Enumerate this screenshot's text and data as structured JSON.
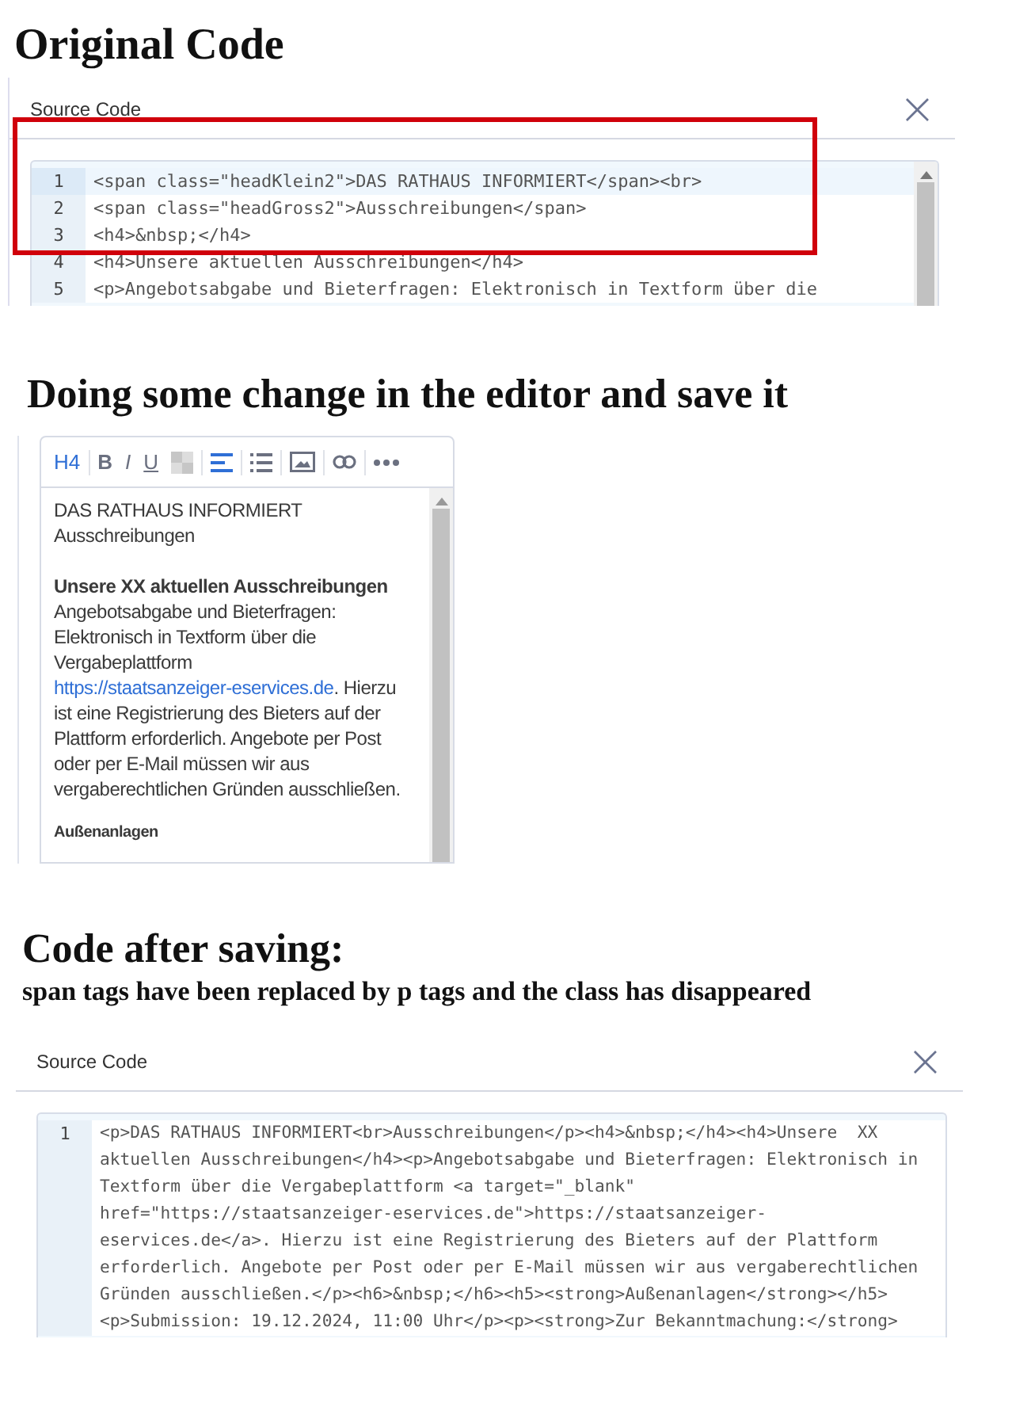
{
  "sections": [
    {
      "kind": "dialog",
      "heading": "Original Code",
      "highlight": true,
      "dialog": {
        "title": "Source Code",
        "close": "×",
        "lines": [
          {
            "number": "1",
            "active": true,
            "segments": [
              "<span class=\"headKlein2\">DAS RATHAUS INFORMIERT</span><br>"
            ]
          },
          {
            "number": "2",
            "active": false,
            "segments": [
              "<span class=\"headGross2\">Ausschreibungen</span>"
            ]
          },
          {
            "number": "3",
            "active": false,
            "segments": [
              "<h4>&nbsp;</h4>"
            ]
          },
          {
            "number": "4",
            "active": false,
            "segments": [
              "<h4>Unsere aktuellen Ausschreibungen</h4>"
            ]
          },
          {
            "number": "5",
            "active": false,
            "segments": [
              "<p>Angebotsabgabe und Bieterfragen: Elektronisch in Textform über die"
            ]
          }
        ]
      }
    },
    {
      "kind": "editor",
      "heading": "Doing some change in the editor and save it",
      "editor": {
        "toolbar": [
          {
            "kind": "text",
            "label": "H4",
            "selected": true
          },
          {
            "kind": "text",
            "label": "B",
            "selected": false
          },
          {
            "kind": "text",
            "label": "I",
            "selected": false
          },
          {
            "kind": "text",
            "label": "U",
            "selected": false
          },
          {
            "kind": "checker",
            "selected": false
          },
          {
            "kind": "align",
            "selected": true
          },
          {
            "kind": "list",
            "selected": false
          },
          {
            "kind": "image",
            "selected": false
          },
          {
            "kind": "link",
            "selected": false
          },
          {
            "kind": "more",
            "selected": false
          }
        ],
        "blocks": [
          {
            "kind": "plain",
            "lines": [
              "DAS RATHAUS INFORMIERT",
              "Ausschreibungen"
            ]
          },
          {
            "kind": "heading",
            "text": "Unsere  XX aktuellen Ausschreibungen"
          },
          {
            "kind": "paragraph",
            "before": "Angebotsabgabe und Bieterfragen: Elektronisch in Textform über die Vergabeplattform ",
            "link": "https://staatsanzeiger-eservices.de",
            "after": ". Hierzu ist eine Registrierung des Bieters auf der Plattform erforderlich. Angebote per Post oder per E-Mail müssen wir aus vergaberechtlichen Gründen ausschließen."
          },
          {
            "kind": "small-heading",
            "text": "Außenanlagen"
          }
        ]
      }
    },
    {
      "kind": "dialog",
      "heading": "Code after saving:",
      "subtitle": "span tags have been replaced by p tags and the class has disappeared",
      "highlight": false,
      "dialog": {
        "title": "Source Code",
        "close": "×",
        "lines": [
          {
            "number": "1",
            "active": false,
            "segments": [
              "<p>DAS RATHAUS INFORMIERT<br>Ausschreibungen</p><h4>&nbsp;</h4><h4>Unsere  XX",
              "aktuellen Ausschreibungen</h4><p>Angebotsabgabe und Bieterfragen: Elektronisch in",
              "Textform über die Vergabeplattform <a target=\"_blank\"",
              "href=\"https://staatsanzeiger-eservices.de\">https://staatsanzeiger-",
              "eservices.de</a>. Hierzu ist eine Registrierung des Bieters auf der Plattform",
              "erforderlich. Angebote per Post oder per E-Mail müssen wir aus vergaberechtlichen",
              "Gründen ausschließen.</p><h6>&nbsp;</h6><h5><strong>Außenanlagen</strong></h5>",
              "<p>Submission: 19.12.2024, 11:00 Uhr</p><p><strong>Zur Bekanntmachung:</strong>"
            ]
          }
        ]
      }
    }
  ]
}
